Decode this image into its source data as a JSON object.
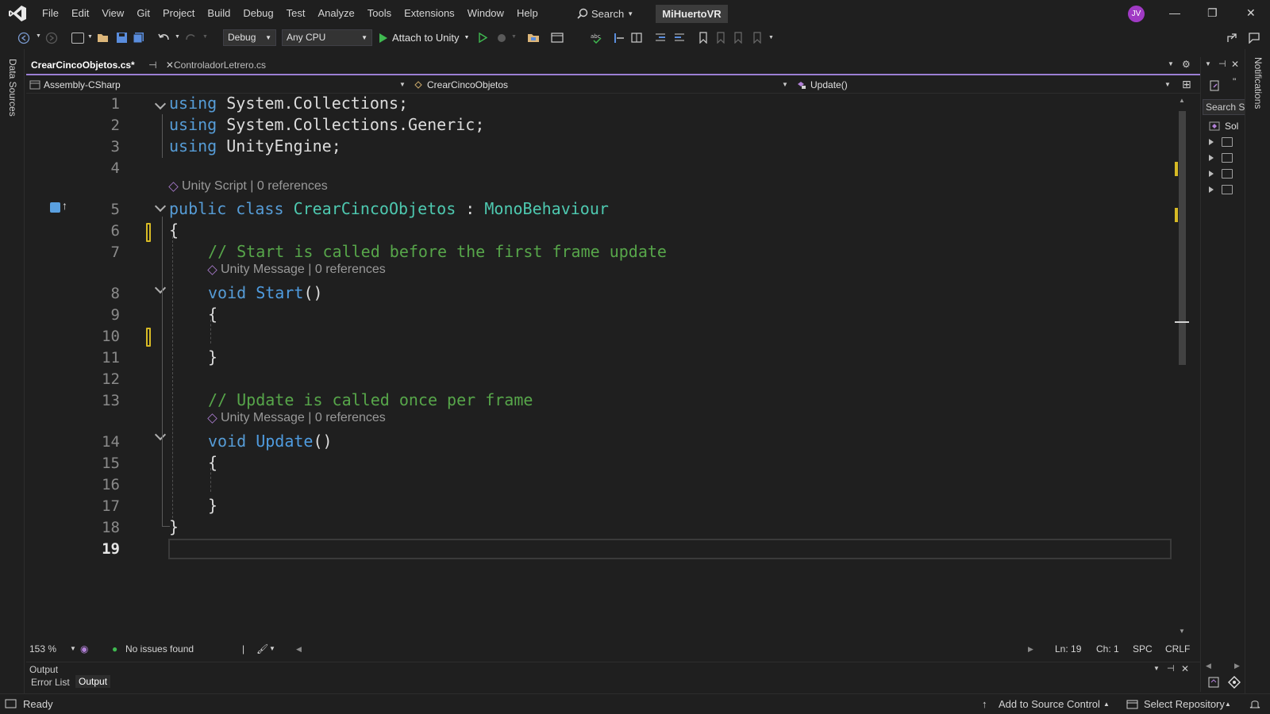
{
  "menu": [
    "File",
    "Edit",
    "View",
    "Git",
    "Project",
    "Build",
    "Debug",
    "Test",
    "Analyze",
    "Tools",
    "Extensions",
    "Window",
    "Help"
  ],
  "search": {
    "label": "Search"
  },
  "solution_name": "MiHuertoVR",
  "user_initials": "JV",
  "toolbar": {
    "config": "Debug",
    "platform": "Any CPU",
    "attach_label": "Attach to Unity"
  },
  "left_strip_label": "Data Sources",
  "right_strip_label": "Notifications",
  "tabs": [
    {
      "label": "CrearCincoObjetos.cs*",
      "active": true
    },
    {
      "label": "ControladorLetrero.cs",
      "active": false
    }
  ],
  "navbar": {
    "project": "Assembly-CSharp",
    "class": "CrearCincoObjetos",
    "member": "Update()"
  },
  "code": {
    "line_numbers": [
      "1",
      "2",
      "3",
      "4",
      "5",
      "6",
      "7",
      "8",
      "9",
      "10",
      "11",
      "12",
      "13",
      "14",
      "15",
      "16",
      "17",
      "18",
      "19"
    ],
    "l1_kw": "using",
    "l1_rest": " System.Collections;",
    "l2_kw": "using",
    "l2_rest": " System.Collections.Generic;",
    "l3_kw": "using",
    "l3_rest": " UnityEngine;",
    "hint_class": "Unity Script | 0 references",
    "l5_kw1": "public",
    "l5_kw2": "class",
    "l5_name": "CrearCincoObjetos",
    "l5_colon": " : ",
    "l5_base": "MonoBehaviour",
    "l6": "{",
    "l7": "// Start is called before the first frame update",
    "hint_start": "Unity Message | 0 references",
    "l8_kw": "void",
    "l8_fn": "Start",
    "l8_paren": "()",
    "l9": "{",
    "l11": "}",
    "l13": "// Update is called once per frame",
    "hint_update": "Unity Message | 0 references",
    "l14_kw": "void",
    "l14_fn": "Update",
    "l14_paren": "()",
    "l15": "{",
    "l17": "}",
    "l18": "}"
  },
  "editor_status": {
    "zoom": "153 %",
    "issues": "No issues found",
    "line": "Ln: 19",
    "col": "Ch: 1",
    "spc": "SPC",
    "eol": "CRLF"
  },
  "output_panel": {
    "title": "Output",
    "tabs": [
      "Error List",
      "Output"
    ]
  },
  "solution_explorer": {
    "search_placeholder": "Search S",
    "root": "Sol"
  },
  "statusbar": {
    "ready": "Ready",
    "source_control": "Add to Source Control",
    "repo": "Select Repository"
  },
  "colors": {
    "accent": "#9b7fd4",
    "keyword": "#569cd6",
    "type": "#4ec9b0",
    "comment": "#57a64a"
  }
}
